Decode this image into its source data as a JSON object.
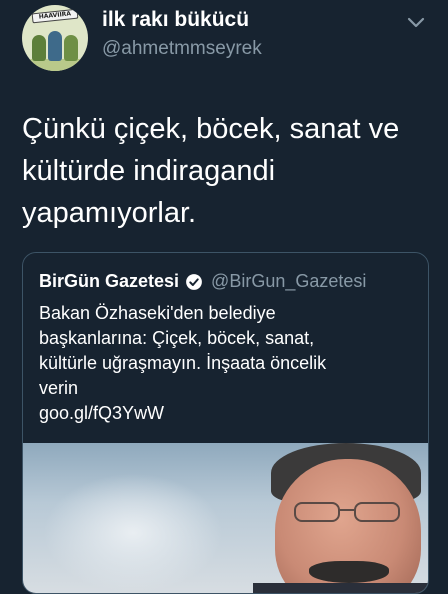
{
  "tweet": {
    "author": {
      "display_name": "ilk rakı bükücü",
      "handle": "@ahmetmmseyrek",
      "avatar_banner_text": "HAAVIIRA"
    },
    "text_lines": [
      "Çünkü çiçek, böcek, sanat ve",
      "kültürde indiragandi",
      "yapamıyorlar."
    ]
  },
  "quoted_tweet": {
    "author": {
      "display_name": "BirGün Gazetesi",
      "handle": "@BirGun_Gazetesi",
      "verified": true
    },
    "text_lines": [
      "Bakan Özhaseki'den belediye",
      "başkanlarına: Çiçek, böcek, sanat,",
      "kültürle uğraşmayın. İnşaata öncelik",
      "verin",
      "goo.gl/fQ3YwW"
    ]
  },
  "colors": {
    "background": "#172330",
    "text_primary": "#ffffff",
    "text_secondary": "#8899a6",
    "border": "#3d5466",
    "verified_badge": "#ffffff"
  },
  "icons": {
    "menu": "chevron-down-icon",
    "verified": "verified-badge-icon"
  }
}
